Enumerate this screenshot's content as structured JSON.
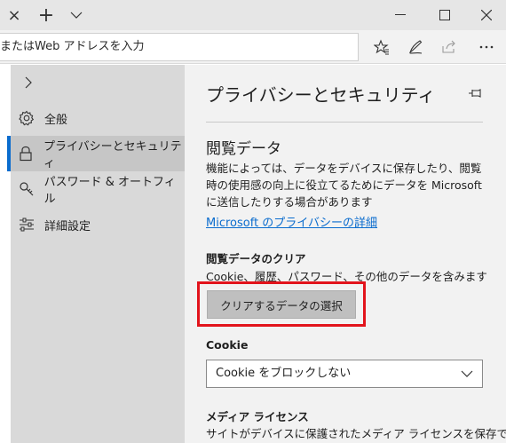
{
  "titlebar": {
    "close_tab": "×",
    "new_tab": "+",
    "tab_list": "∨"
  },
  "addressbar": {
    "text": "またはWeb アドレスを入力"
  },
  "left_pane": {
    "items": [
      {
        "label": "全般",
        "icon": "gear-icon"
      },
      {
        "label": "プライバシーとセキュリティ",
        "icon": "lock-icon"
      },
      {
        "label": "パスワード & オートフィル",
        "icon": "key-icon"
      },
      {
        "label": "詳細設定",
        "icon": "sliders-icon"
      }
    ]
  },
  "right_pane": {
    "title": "プライバシーとセキュリティ",
    "browsing_heading": "閲覧データ",
    "browsing_desc": "機能によっては、データをデバイスに保存したり、閲覧時の使用感の向上に役立てるためにデータを Microsoft に送信したりする場合があります",
    "privacy_link": "Microsoft のプライバシーの詳細",
    "clear_heading": "閲覧データのクリア",
    "clear_desc": "Cookie、履歴、パスワード、その他のデータを含みます",
    "clear_button": "クリアするデータの選択",
    "cookie_label": "Cookie",
    "cookie_value": "Cookie をブロックしない",
    "media_heading": "メディア ライセンス",
    "media_desc": "サイトがデバイスに保護されたメディア ライセンスを保存で"
  },
  "colors": {
    "accent": "#0a6cce",
    "highlight": "#e2141c"
  }
}
